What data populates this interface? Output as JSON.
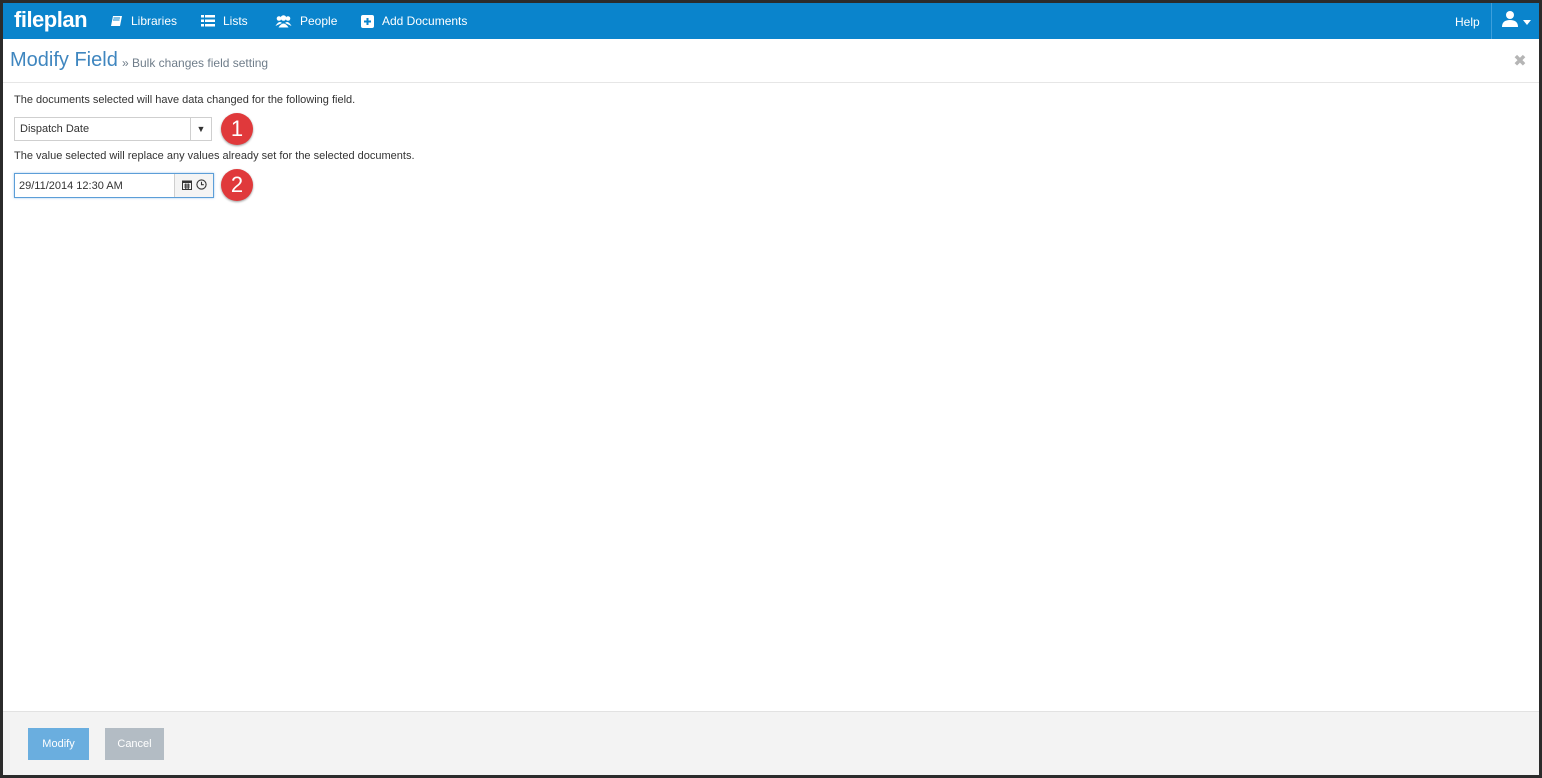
{
  "nav": {
    "logo": "fileplan",
    "items": [
      {
        "label": "Libraries",
        "icon": "book-icon"
      },
      {
        "label": "Lists",
        "icon": "list-icon"
      },
      {
        "label": "People",
        "icon": "people-icon"
      },
      {
        "label": "Add Documents",
        "icon": "plus-square-icon"
      }
    ],
    "help": "Help",
    "user_icon": "user-icon"
  },
  "header": {
    "title": "Modify Field",
    "subtitle": "» Bulk changes field setting"
  },
  "form": {
    "intro": "The documents selected will have data changed for the following field.",
    "field_select_value": "Dispatch Date",
    "replace_note": "The value selected will replace any values already set for the selected documents.",
    "date_value": "29/11/2014 12:30 AM"
  },
  "markers": [
    "1",
    "2"
  ],
  "footer": {
    "modify_label": "Modify",
    "cancel_label": "Cancel"
  },
  "colors": {
    "nav_bg": "#0a84cc",
    "title": "#3f86bf",
    "marker": "#e0393b",
    "modify_btn": "#6aaedf",
    "cancel_btn": "#b3bcc4"
  }
}
